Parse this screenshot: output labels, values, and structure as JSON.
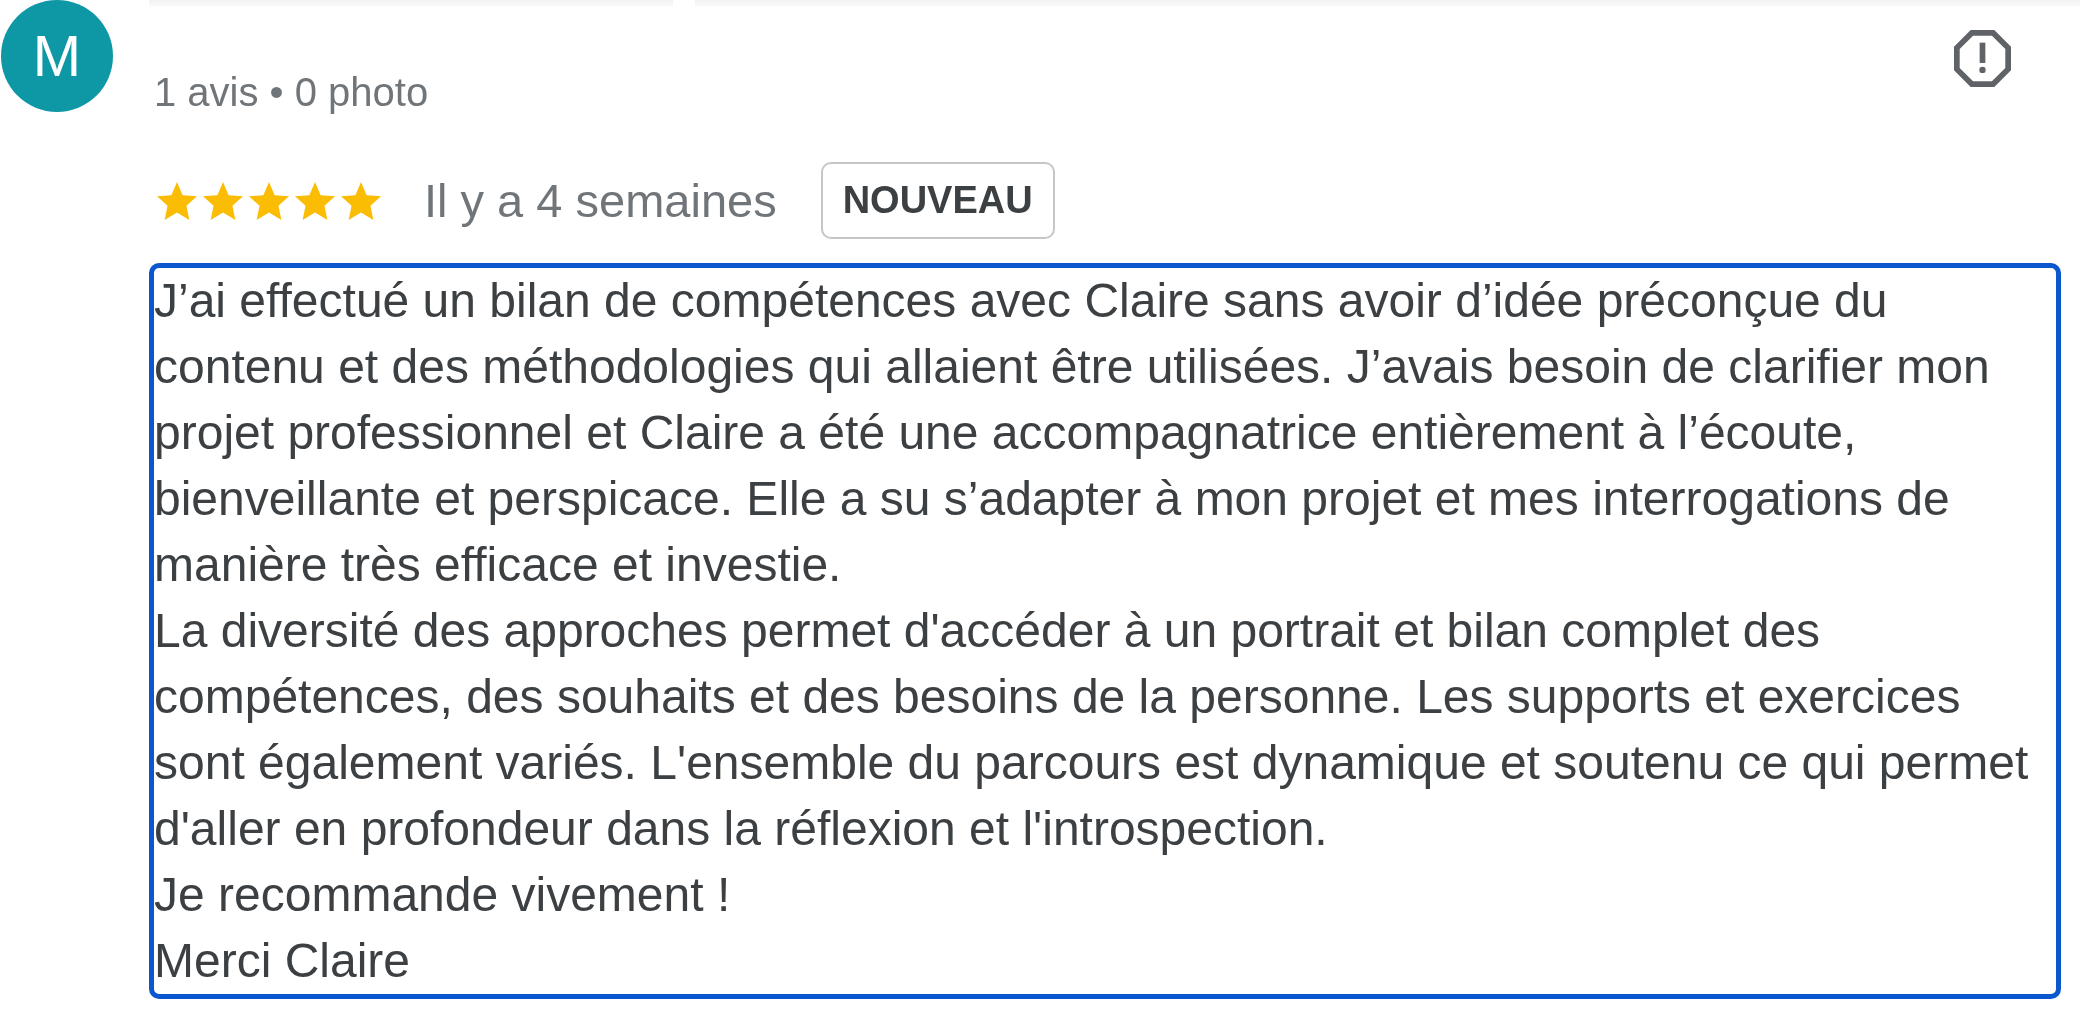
{
  "reviewer": {
    "initial": "M",
    "stats": "1 avis • 0 photo"
  },
  "review": {
    "stars": 5,
    "date": "Il y a 4 semaines",
    "badge": "NOUVEAU",
    "paragraphs": [
      "J’ai effectué un bilan de compétences avec Claire sans avoir d’idée préconçue du contenu et des méthodologies qui allaient être utilisées. J’avais besoin de clarifier mon projet professionnel et Claire a été une accompagnatrice entièrement à l’écoute, bienveillante et perspicace. Elle a su s’adapter à mon projet et mes interrogations de manière très efficace et investie.",
      "La diversité des approches permet d'accéder à un portrait et bilan complet des compétences, des souhaits et des besoins de la personne. Les supports et exercices sont également variés. L'ensemble du parcours est dynamique et soutenu ce qui permet d'aller en profondeur dans la réflexion et l'introspection.",
      "Je recommande vivement !",
      "Merci Claire"
    ]
  }
}
